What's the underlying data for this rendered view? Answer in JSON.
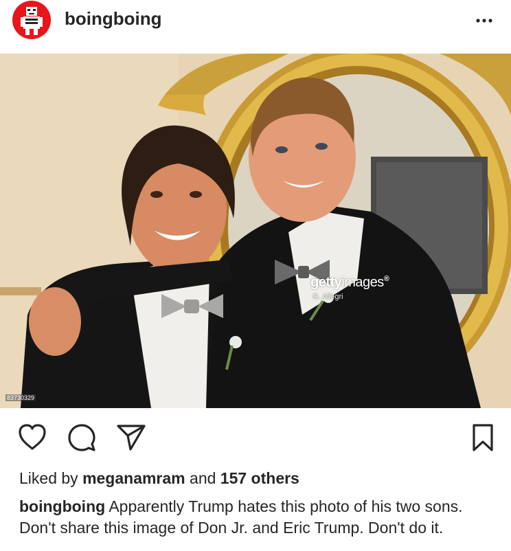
{
  "post": {
    "username": "boingboing",
    "more_icon": "more-horizontal-icon",
    "photo": {
      "watermark_bold": "getty",
      "watermark_light": "images",
      "watermark_mark": "®",
      "credit": "G. Allegri",
      "image_id": "83730329"
    },
    "actions": {
      "like_icon": "heart-icon",
      "comment_icon": "comment-icon",
      "share_icon": "send-icon",
      "save_icon": "bookmark-icon"
    },
    "likes": {
      "prefix": "Liked by",
      "user": "meganamram",
      "middle": "and",
      "count_text": "157 others"
    },
    "caption": {
      "user": "boingboing",
      "text": "Apparently Trump hates this photo of his two sons. Don't share this image of Don Jr. and Eric Trump. Don't do it."
    }
  },
  "colors": {
    "avatar_bg": "#e8151b",
    "text": "#262626"
  }
}
